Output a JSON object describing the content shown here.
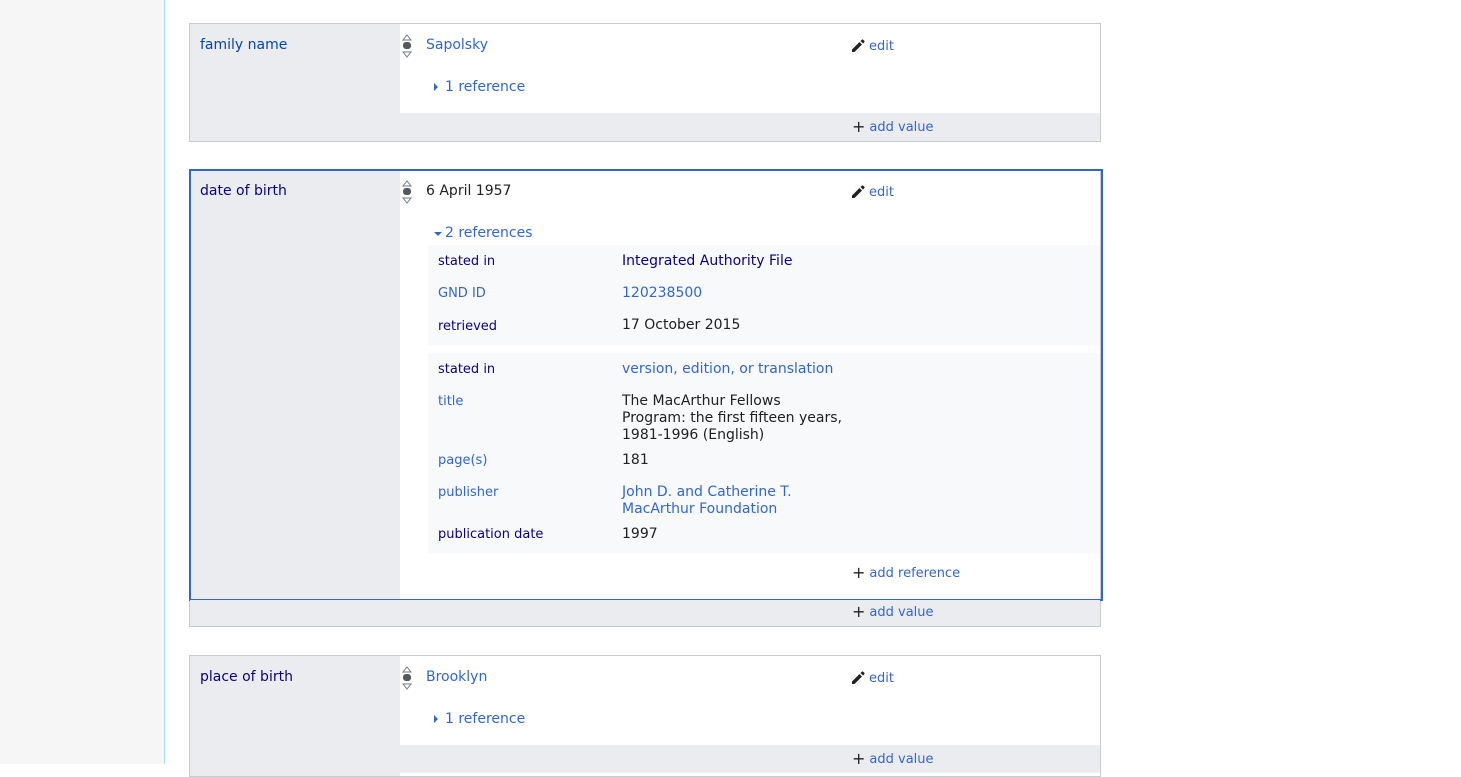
{
  "statements": {
    "family_name": {
      "property": "family name",
      "value": "Sapolsky",
      "edit": "edit",
      "refs": "1 reference",
      "add_value": "add value"
    },
    "date_of_birth": {
      "property": "date of birth",
      "value": "6 April 1957",
      "edit": "edit",
      "refs": "2 references",
      "ref1": {
        "stated_in_label": "stated in",
        "stated_in_value": "Integrated Authority File",
        "gnd_label": "GND ID",
        "gnd_value": "120238500",
        "retrieved_label": "retrieved",
        "retrieved_value": "17 October 2015"
      },
      "ref2": {
        "stated_in_label": "stated in",
        "stated_in_value": "version, edition, or translation",
        "title_label": "title",
        "title_line1": "The MacArthur Fellows",
        "title_line2": "Program: the first fifteen years,",
        "title_line3": "1981-1996 (English)",
        "pages_label": "page(s)",
        "pages_value": "181",
        "publisher_label": "publisher",
        "publisher_line1": "John D. and Catherine T.",
        "publisher_line2": "MacArthur Foundation",
        "pubdate_label": "publication date",
        "pubdate_value": "1997"
      },
      "add_reference": "add reference",
      "add_value": "add value"
    },
    "place_of_birth": {
      "property": "place of birth",
      "value": "Brooklyn",
      "edit": "edit",
      "refs": "1 reference",
      "add_value": "add value"
    }
  },
  "icons": {
    "edit": "pencil-icon",
    "rank": "rank-normal-icon",
    "add": "plus-icon",
    "expand": "triangle-right-icon",
    "collapse": "triangle-down-icon"
  },
  "colors": {
    "link": "#3366cc",
    "property_label": "#0645ad",
    "focus_border": "#3366cc",
    "gray_band": "#eaecf0"
  }
}
